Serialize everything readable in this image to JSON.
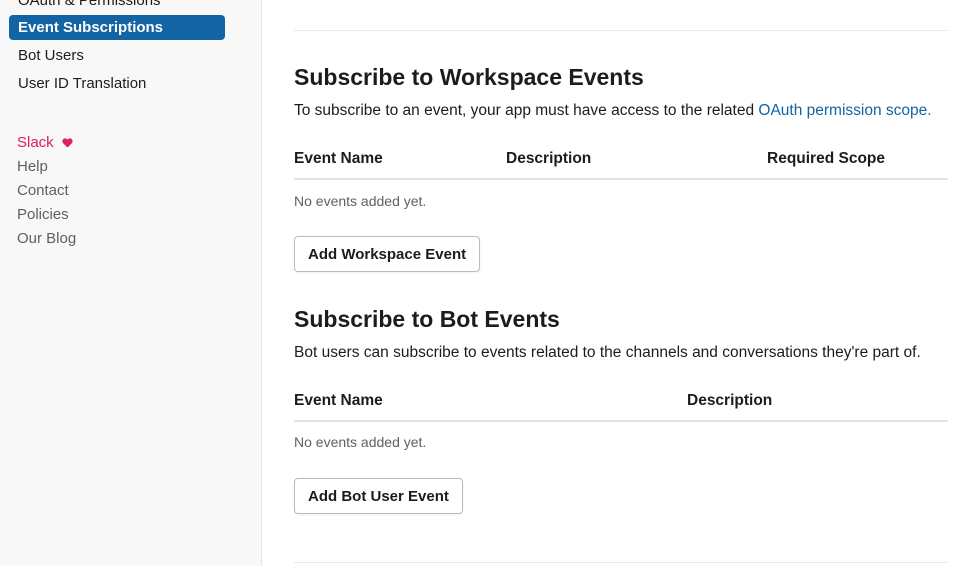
{
  "sidebar": {
    "nav_items": [
      {
        "label": "OAuth & Permissions",
        "active": false
      },
      {
        "label": "Event Subscriptions",
        "active": true
      },
      {
        "label": "Bot Users",
        "active": false
      },
      {
        "label": "User ID Translation",
        "active": false
      }
    ],
    "footer_links": {
      "slack": "Slack",
      "help": "Help",
      "contact": "Contact",
      "policies": "Policies",
      "blog": "Our Blog"
    }
  },
  "workspace_events": {
    "title": "Subscribe to Workspace Events",
    "description_prefix": "To subscribe to an event, your app must have access to the related ",
    "description_link": "OAuth permission scope.",
    "columns": [
      "Event Name",
      "Description",
      "Required Scope"
    ],
    "empty_text": "No events added yet.",
    "button_label": "Add Workspace Event"
  },
  "bot_events": {
    "title": "Subscribe to Bot Events",
    "description": "Bot users can subscribe to events related to the channels and conversations they're part of.",
    "columns": [
      "Event Name",
      "Description"
    ],
    "empty_text": "No events added yet.",
    "button_label": "Add Bot User Event"
  },
  "colors": {
    "accent": "#1264a3",
    "slack_heart": "#e01e5a"
  }
}
